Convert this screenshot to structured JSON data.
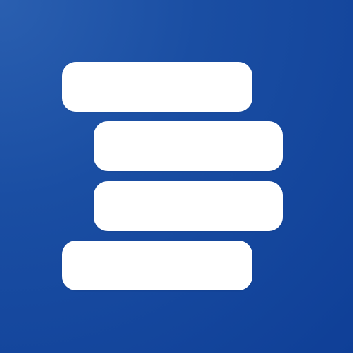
{
  "icon": {
    "name": "stacked-bars-logo",
    "background_color": "#1a4ea3",
    "bar_color": "#ffffff"
  }
}
